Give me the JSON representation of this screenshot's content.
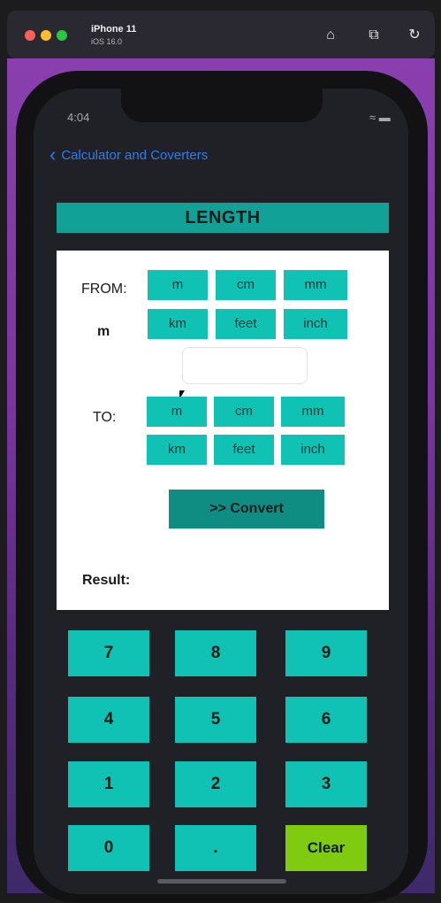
{
  "simulator": {
    "device": "iPhone 11",
    "os": "iOS 16.0"
  },
  "status": {
    "time": "4:04"
  },
  "nav": {
    "back_label": "Calculator and Coverters"
  },
  "title": "LENGTH",
  "from": {
    "label": "FROM:",
    "selected": "m",
    "units": [
      "m",
      "cm",
      "mm",
      "km",
      "feet",
      "inch"
    ]
  },
  "input": {
    "value": ""
  },
  "to": {
    "label": "TO:",
    "units": [
      "m",
      "cm",
      "mm",
      "km",
      "feet",
      "inch"
    ]
  },
  "convert": {
    "icon": ">>",
    "label": "Convert"
  },
  "result": {
    "label": "Result:",
    "value": ""
  },
  "keypad": [
    "7",
    "8",
    "9",
    "4",
    "5",
    "6",
    "1",
    "2",
    "3",
    "0",
    ".",
    "Clear"
  ],
  "colors": {
    "teal": "#10c2b4",
    "title_teal": "#11a197",
    "convert": "#0f8d83",
    "clear": "#7fcb10",
    "link_blue": "#2f7cf6"
  }
}
